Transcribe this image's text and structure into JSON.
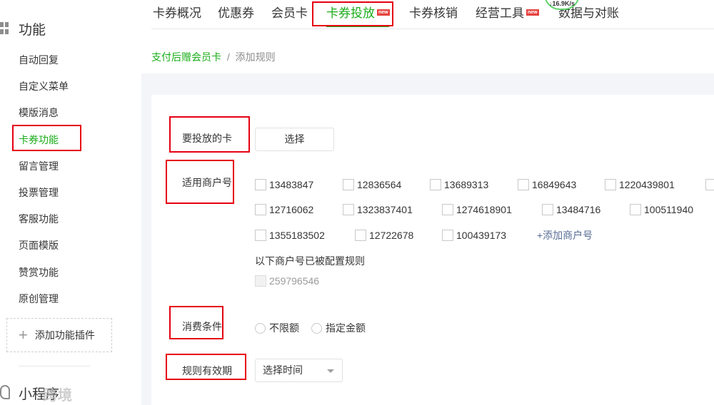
{
  "sidebar": {
    "section_title": "功能",
    "items": [
      {
        "label": "自动回复"
      },
      {
        "label": "自定义菜单"
      },
      {
        "label": "模版消息"
      },
      {
        "label": "卡券功能"
      },
      {
        "label": "留言管理"
      },
      {
        "label": "投票管理"
      },
      {
        "label": "客服功能"
      },
      {
        "label": "页面模版"
      },
      {
        "label": "赞赏功能"
      },
      {
        "label": "原创管理"
      }
    ],
    "add_plugin": "添加功能插件",
    "mini_program": "小程序",
    "watermark": "跨境"
  },
  "tabs": [
    {
      "label": "卡券概况"
    },
    {
      "label": "优惠券"
    },
    {
      "label": "会员卡"
    },
    {
      "label": "卡券投放",
      "badge": "new"
    },
    {
      "label": "卡券核销"
    },
    {
      "label": "经营工具",
      "badge": "new"
    },
    {
      "label": "数据与对账"
    }
  ],
  "network_speed": "↓16.9K/s",
  "breadcrumb": {
    "link": "支付后赠会员卡",
    "separator": "/",
    "current": "添加规则"
  },
  "form": {
    "card_label": "要投放的卡",
    "card_button": "选择",
    "merchant_label": "适用商户号",
    "merchants": [
      "13483847",
      "12836564",
      "13689313",
      "16849643",
      "1220439801",
      "12716062",
      "1323837401",
      "1274618901",
      "13484716",
      "100511940",
      "1355183502",
      "12722678",
      "100439173"
    ],
    "add_merchant": "+添加商户号",
    "configured_note": "以下商户号已被配置规则",
    "configured_merchants": [
      "259796546"
    ],
    "condition_label": "消费条件",
    "condition_options": [
      "不限额",
      "指定金额"
    ],
    "validity_label": "规则有效期",
    "validity_select": "选择时间"
  },
  "colors": {
    "accent": "#1aad19",
    "link": "#576b95",
    "highlight": "#e60012",
    "badge": "#e64340"
  }
}
